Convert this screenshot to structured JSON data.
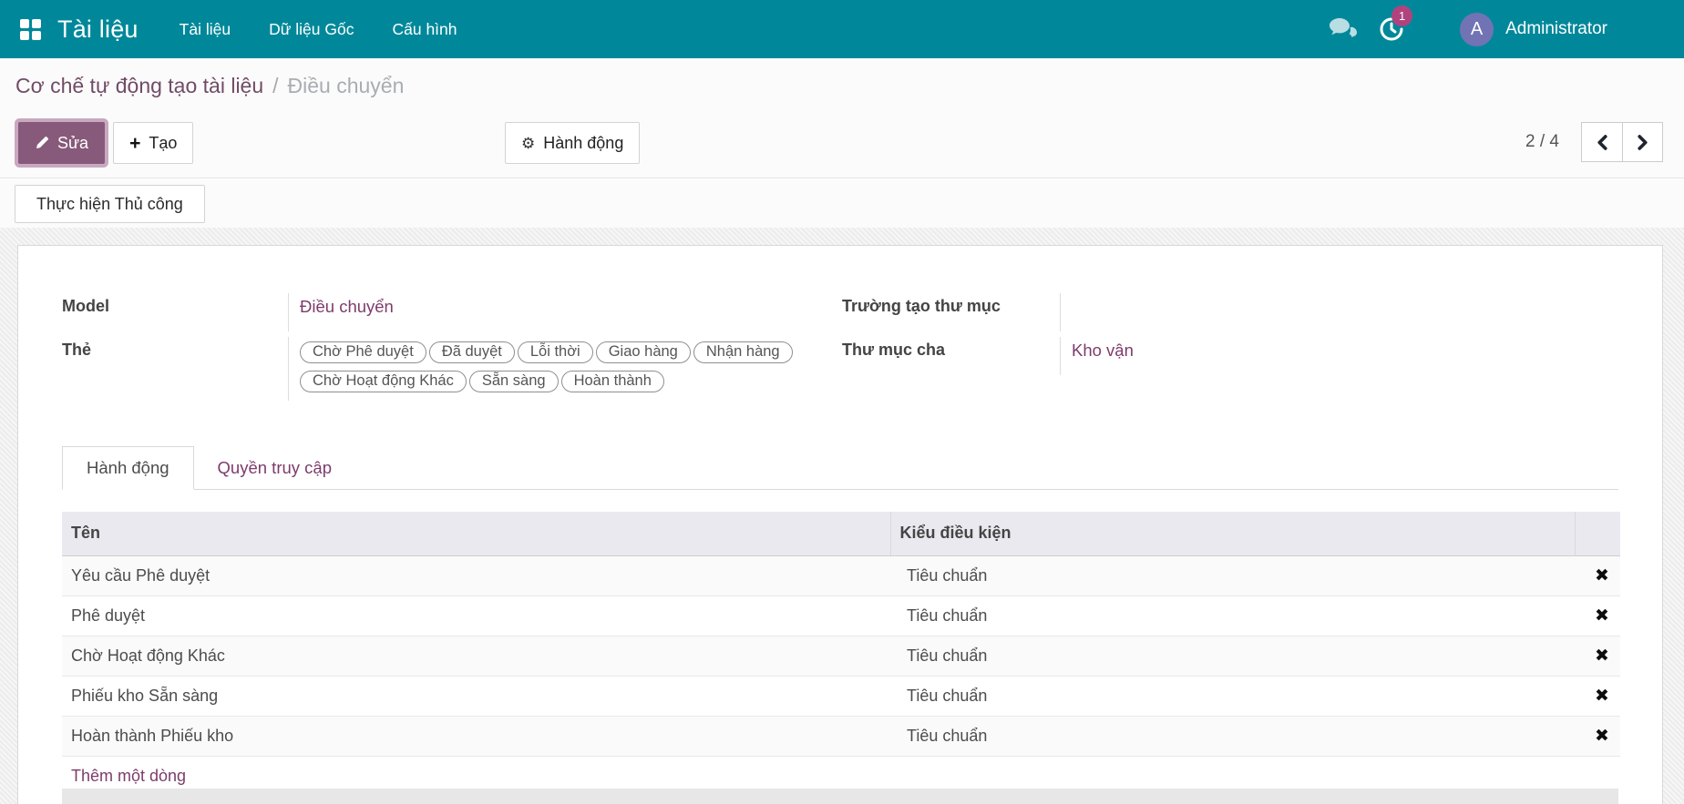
{
  "theme": {
    "navbar_bg": "#00889a",
    "primary": "#875a7b",
    "primary_ring": "#c9a8c0",
    "link": "#7d3b6b",
    "breadcrumb_link": "#714b67",
    "badge": "#b0437e",
    "avatar_bg": "#7173b4",
    "header_bg": "#e9e9ef"
  },
  "navbar": {
    "brand": "Tài liệu",
    "menu": [
      {
        "label": "Tài liệu"
      },
      {
        "label": "Dữ liệu Gốc"
      },
      {
        "label": "Cấu hình"
      }
    ],
    "icons": {
      "messages": "chat-bubbles-icon",
      "activity": "activity-clock-icon"
    },
    "activity_badge": "1",
    "user": {
      "initial": "A",
      "name": "Administrator"
    }
  },
  "breadcrumb": {
    "parent": "Cơ chế tự động tạo tài liệu",
    "separator": "/",
    "current": "Điều chuyển"
  },
  "control": {
    "edit_label": "Sửa",
    "create_label": "Tạo",
    "action_label": "Hành động",
    "pager_value": "2 / 4"
  },
  "manual": {
    "label": "Thực hiện Thủ công"
  },
  "form": {
    "model": {
      "label": "Model",
      "value": "Điều chuyển"
    },
    "tags": {
      "label": "Thẻ",
      "items": [
        "Chờ Phê duyệt",
        "Đã duyệt",
        "Lỗi thời",
        "Giao hàng",
        "Nhận hàng",
        "Chờ Hoạt động Khác",
        "Sẵn sàng",
        "Hoàn thành"
      ]
    },
    "folder_field": {
      "label": "Trường tạo thư mục",
      "value": ""
    },
    "parent_folder": {
      "label": "Thư mục cha",
      "value": "Kho vận"
    }
  },
  "tabs": [
    {
      "label": "Hành động",
      "active": true
    },
    {
      "label": "Quyền truy cập",
      "active": false
    }
  ],
  "table": {
    "columns": {
      "name": "Tên",
      "condition": "Kiểu điều kiện"
    },
    "rows": [
      {
        "name": "Yêu cầu Phê duyệt",
        "condition": "Tiêu chuẩn"
      },
      {
        "name": "Phê duyệt",
        "condition": "Tiêu chuẩn"
      },
      {
        "name": "Chờ Hoạt động Khác",
        "condition": "Tiêu chuẩn"
      },
      {
        "name": "Phiếu kho Sẵn sàng",
        "condition": "Tiêu chuẩn"
      },
      {
        "name": "Hoàn thành Phiếu kho",
        "condition": "Tiêu chuẩn"
      }
    ],
    "delete_glyph": "✖",
    "add_line": "Thêm một dòng"
  }
}
